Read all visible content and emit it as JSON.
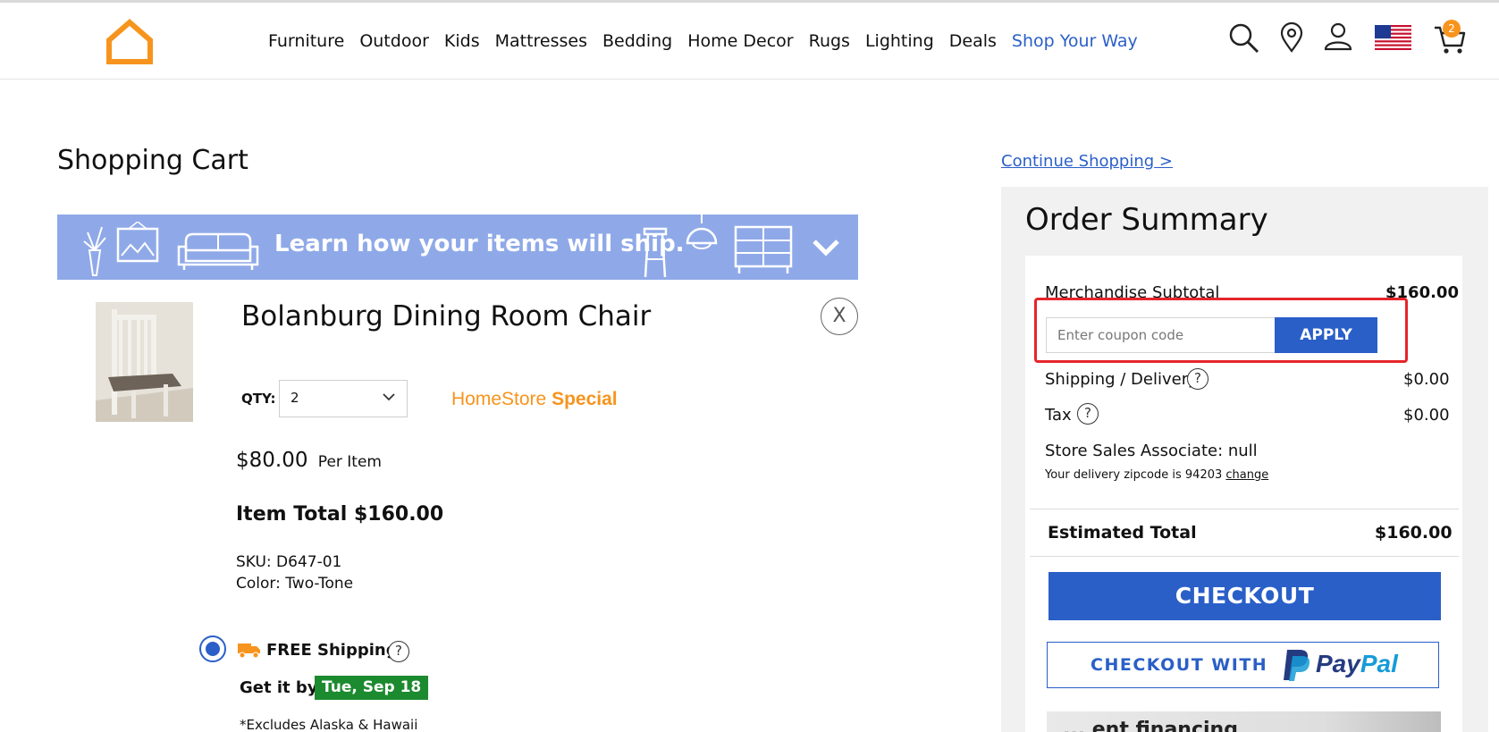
{
  "nav": {
    "items": [
      "Furniture",
      "Outdoor",
      "Kids",
      "Mattresses",
      "Bedding",
      "Home Decor",
      "Rugs",
      "Lighting",
      "Deals"
    ],
    "accent_item": "Shop Your Way",
    "cart_count": "2",
    "icons": [
      "home-logo-icon",
      "search-icon",
      "location-pin-icon",
      "user-icon",
      "us-flag-icon",
      "cart-icon"
    ]
  },
  "cart": {
    "title": "Shopping Cart",
    "ship_banner": "Learn how your items will ship.",
    "product": {
      "name": "Bolanburg Dining Room Chair",
      "remove": "X",
      "qty_label": "QTY:",
      "qty_value": "2",
      "special_prefix": "HomeStore",
      "special_bold": "Special",
      "price": "$80.00",
      "price_suffix": "Per Item",
      "item_total": "Item Total $160.00",
      "sku": "SKU: D647-01",
      "color": "Color: Two-Tone"
    },
    "shipping": {
      "free_label": "FREE Shipping",
      "help": "?",
      "get_it_by": "Get it by",
      "date": "Tue, Sep 18",
      "excludes": "*Excludes Alaska & Hawaii"
    }
  },
  "summary": {
    "continue_link": "Continue Shopping >",
    "title": "Order Summary",
    "merch_label": "Merchandise Subtotal",
    "merch_value": "$160.00",
    "coupon_placeholder": "Enter coupon code",
    "apply_label": "APPLY",
    "shipping_label": "Shipping / Delivery",
    "shipping_value": "$0.00",
    "tax_label": "Tax",
    "tax_value": "$0.00",
    "help": "?",
    "associate": "Store Sales Associate: null",
    "zip_text": "Your delivery zipcode is 94203",
    "zip_change": "change",
    "estimated_label": "Estimated Total",
    "estimated_value": "$160.00",
    "checkout_label": "CHECKOUT",
    "paypal_prefix": "CHECKOUT WITH",
    "paypal_pay": "Pay",
    "paypal_pal": "Pal",
    "financing_text": "... ent financing"
  },
  "colors": {
    "accent_blue": "#2a5fc8",
    "orange": "#f7941d",
    "banner_blue": "#8fa9e8",
    "green_badge": "#1c8a2f",
    "highlight_red": "#e5252a"
  }
}
